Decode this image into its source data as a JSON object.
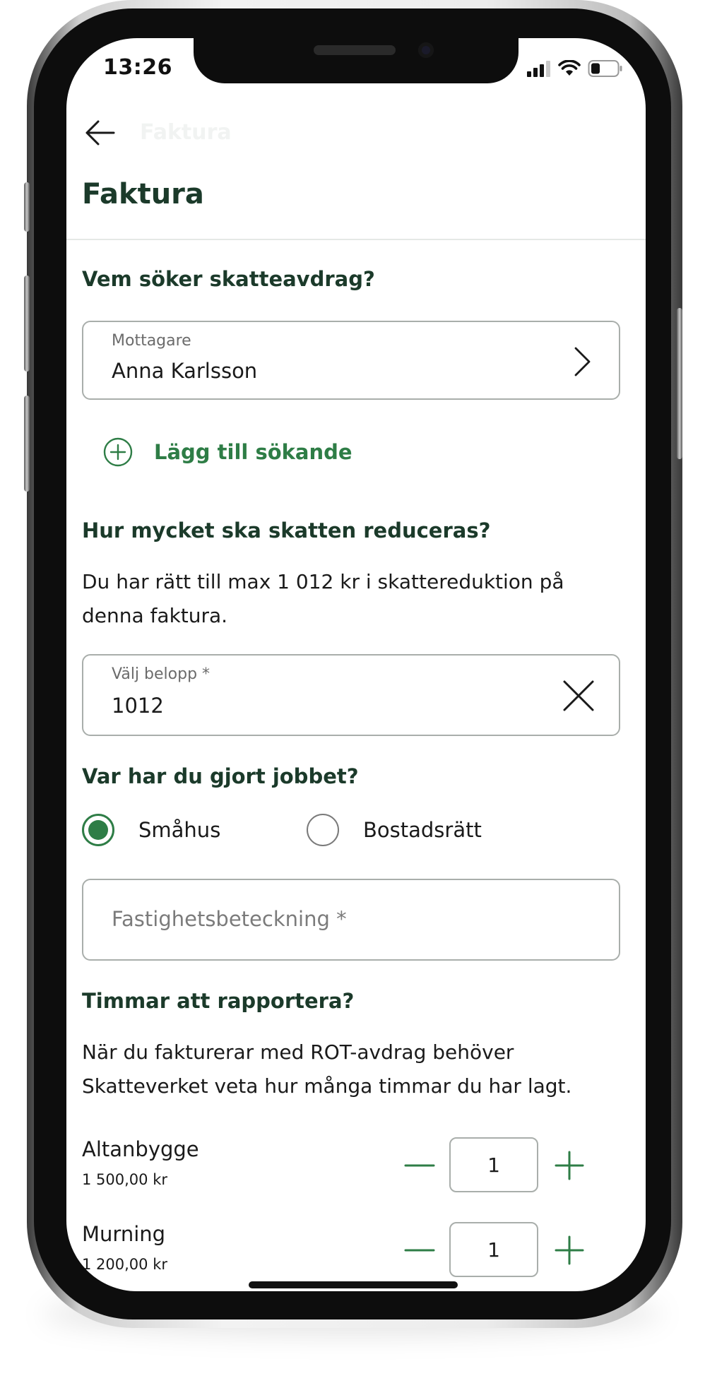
{
  "status_bar": {
    "time": "13:26"
  },
  "nav": {
    "ghost_title": "Faktura",
    "back_icon": "arrow-left-icon"
  },
  "page": {
    "title": "Faktura"
  },
  "applicant": {
    "heading": "Vem söker skatteavdrag?",
    "field_label": "Mottagare",
    "field_value": "Anna Karlsson",
    "add_label": "Lägg till sökande"
  },
  "reduction": {
    "heading": "Hur mycket ska skatten reduceras?",
    "text": "Du har rätt till max 1 012 kr i skattereduktion på denna faktura.",
    "field_label": "Välj belopp *",
    "field_value": "1012"
  },
  "location": {
    "heading": "Var har du gjort jobbet?",
    "options": [
      {
        "label": "Småhus",
        "selected": true
      },
      {
        "label": "Bostadsrätt",
        "selected": false
      }
    ],
    "property_placeholder": "Fastighetsbeteckning *"
  },
  "hours": {
    "heading": "Timmar att rapportera?",
    "text": "När du fakturerar med ROT-avdrag behöver Skatteverket veta hur många timmar du har lagt.",
    "items": [
      {
        "name": "Altanbygge",
        "price": "1 500,00 kr",
        "qty": "1"
      },
      {
        "name": "Murning",
        "price": "1 200,00 kr",
        "qty": "1"
      }
    ]
  },
  "colors": {
    "brand_green": "#2e7d46",
    "heading_green": "#1b3a2a",
    "border": "#a9aeab"
  }
}
